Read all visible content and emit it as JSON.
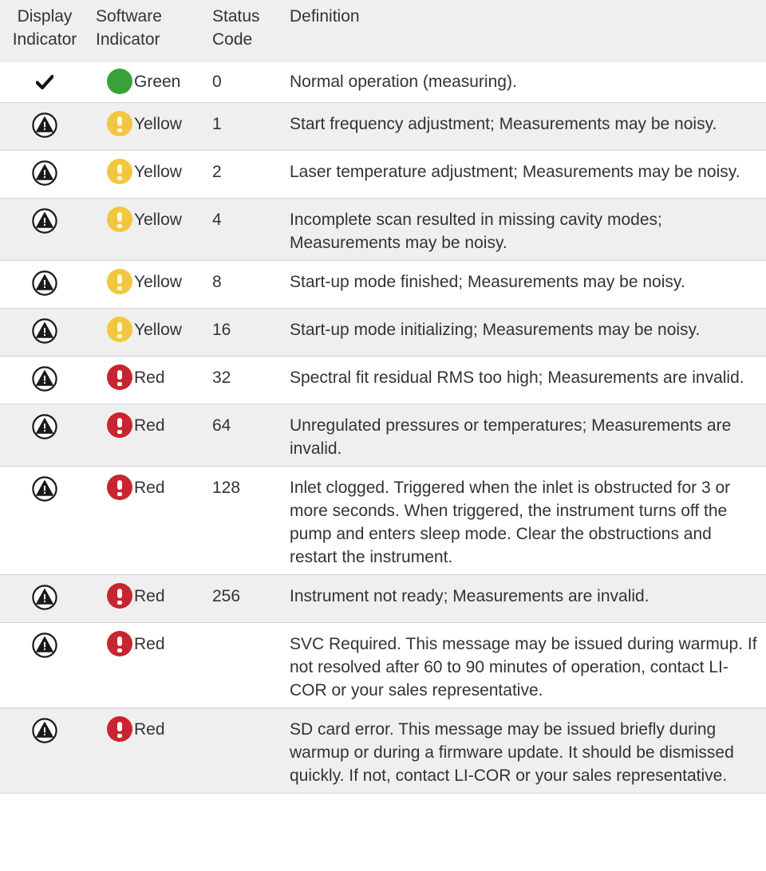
{
  "headers": {
    "display_indicator": [
      "Display",
      "Indicator"
    ],
    "software_indicator": [
      "Software",
      "Indicator"
    ],
    "status_code": [
      "Status",
      "Code"
    ],
    "definition": "Definition"
  },
  "rows": [
    {
      "display_icon": "check-icon",
      "software_icon": "green-circle-icon",
      "software_label": "Green",
      "code": "0",
      "definition": "Normal operation (measuring)."
    },
    {
      "display_icon": "warning-icon",
      "software_icon": "yellow-warning-icon",
      "software_label": "Yellow",
      "code": "1",
      "definition": "Start frequency adjustment; Measurements may be noisy."
    },
    {
      "display_icon": "warning-icon",
      "software_icon": "yellow-warning-icon",
      "software_label": "Yellow",
      "code": "2",
      "definition": "Laser temperature adjustment; Measurements may be noisy."
    },
    {
      "display_icon": "warning-icon",
      "software_icon": "yellow-warning-icon",
      "software_label": "Yellow",
      "code": "4",
      "definition": "Incomplete scan resulted in missing cavity modes; Measurements may be noisy."
    },
    {
      "display_icon": "warning-icon",
      "software_icon": "yellow-warning-icon",
      "software_label": "Yellow",
      "code": "8",
      "definition": "Start-up mode finished; Measurements may be noisy."
    },
    {
      "display_icon": "warning-icon",
      "software_icon": "yellow-warning-icon",
      "software_label": "Yellow",
      "code": "16",
      "definition": "Start-up mode initializing; Measurements may be noisy."
    },
    {
      "display_icon": "warning-icon",
      "software_icon": "red-error-icon",
      "software_label": "Red",
      "code": "32",
      "definition": "Spectral fit residual RMS too high; Measurements are invalid."
    },
    {
      "display_icon": "warning-icon",
      "software_icon": "red-error-icon",
      "software_label": "Red",
      "code": "64",
      "definition": "Unregulated pressures or temperatures; Measurements are invalid."
    },
    {
      "display_icon": "warning-icon",
      "software_icon": "red-error-icon",
      "software_label": "Red",
      "code": "128",
      "definition": "Inlet clogged. Triggered when the inlet is obstructed for 3 or more seconds. When triggered, the instrument turns off the pump and enters sleep mode. Clear the obstructions and restart the instrument."
    },
    {
      "display_icon": "warning-icon",
      "software_icon": "red-error-icon",
      "software_label": "Red",
      "code": "256",
      "definition": "Instrument not ready; Measurements are invalid."
    },
    {
      "display_icon": "warning-icon",
      "software_icon": "red-error-icon",
      "software_label": "Red",
      "code": "",
      "definition": "SVC Required. This message may be issued during warmup. If not resolved after 60 to 90 minutes of operation, contact LI-COR or your sales representative."
    },
    {
      "display_icon": "warning-icon",
      "software_icon": "red-error-icon",
      "software_label": "Red",
      "code": "",
      "definition": "SD card error. This message may be issued briefly during warmup or during a firmware update. It should be dismissed quickly. If not, contact LI-COR or your sales representative."
    }
  ],
  "colors": {
    "green": "#3aa13a",
    "yellow": "#f2c73f",
    "red": "#c8252e",
    "stripe": "#efefef"
  }
}
